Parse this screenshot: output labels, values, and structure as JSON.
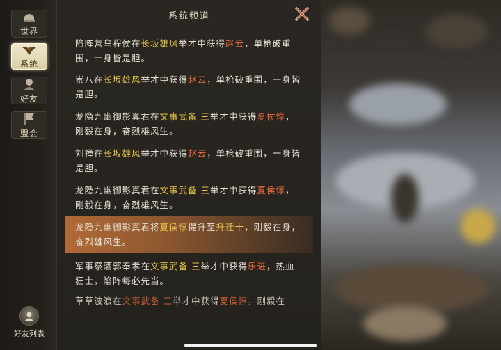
{
  "tabs": [
    {
      "label": "世界",
      "icon": "world-helmet-icon",
      "active": false
    },
    {
      "label": "系统",
      "icon": "system-emblem-icon",
      "active": true
    },
    {
      "label": "好友",
      "icon": "friend-portrait-icon",
      "active": false
    },
    {
      "label": "盟会",
      "icon": "alliance-banner-icon",
      "active": false
    }
  ],
  "friends_list": {
    "label": "好友列表",
    "icon": "friend-avatar-icon"
  },
  "panel": {
    "title": "系统频道",
    "close_icon": "close-x-icon"
  },
  "messages": [
    {
      "segments": [
        {
          "t": "陷阵营乌程侯在"
        },
        {
          "t": "长坂雄风",
          "c": "y"
        },
        {
          "t": "举才中获得"
        },
        {
          "t": "赵云",
          "c": "r"
        },
        {
          "t": "，单枪破重围，一身皆是胆。"
        }
      ]
    },
    {
      "segments": [
        {
          "t": "崇八在"
        },
        {
          "t": "长坂雄风",
          "c": "y"
        },
        {
          "t": "举才中获得"
        },
        {
          "t": "赵云",
          "c": "r"
        },
        {
          "t": "，单枪破重围，一身皆是胆。"
        }
      ]
    },
    {
      "segments": [
        {
          "t": "龙隐九幽御影真君在"
        },
        {
          "t": "文事武备 三",
          "c": "y"
        },
        {
          "t": "举才中获得"
        },
        {
          "t": "夏侯惇",
          "c": "r"
        },
        {
          "t": "，刚毅在身，奋烈雄风生。"
        }
      ]
    },
    {
      "segments": [
        {
          "t": "刘禅在"
        },
        {
          "t": "长坂雄风",
          "c": "y"
        },
        {
          "t": "举才中获得"
        },
        {
          "t": "赵云",
          "c": "r"
        },
        {
          "t": "，单枪破重围，一身皆是胆。"
        }
      ]
    },
    {
      "segments": [
        {
          "t": "龙隐九幽御影真君在"
        },
        {
          "t": "文事武备 三",
          "c": "y"
        },
        {
          "t": "举才中获得"
        },
        {
          "t": "夏侯惇",
          "c": "r"
        },
        {
          "t": "，刚毅在身，奋烈雄风生。"
        }
      ]
    },
    {
      "highlight": true,
      "segments": [
        {
          "t": "龙隐九幽御影真君将"
        },
        {
          "t": "夏侯惇",
          "c": "y"
        },
        {
          "t": "提升至"
        },
        {
          "t": "升迁十",
          "c": "y"
        },
        {
          "t": "，刚毅在身，奋烈雄风生。"
        }
      ]
    },
    {
      "segments": [
        {
          "t": "军事祭酒郭奉孝在"
        },
        {
          "t": "文事武备 三",
          "c": "y"
        },
        {
          "t": "举才中获得"
        },
        {
          "t": "乐进",
          "c": "r"
        },
        {
          "t": "，热血狂士，陷阵每必先当。"
        }
      ]
    },
    {
      "cut": true,
      "segments": [
        {
          "t": "草草波浪在"
        },
        {
          "t": "文事武备 三",
          "c": "r"
        },
        {
          "t": "举才中获得"
        },
        {
          "t": "夏侯惇",
          "c": "r"
        },
        {
          "t": "，刚毅在身，奋"
        }
      ]
    }
  ],
  "colors": {
    "highlight_yellow": "#e8c44a",
    "highlight_red": "#e4683c",
    "active_tab": "#efe8cc"
  }
}
